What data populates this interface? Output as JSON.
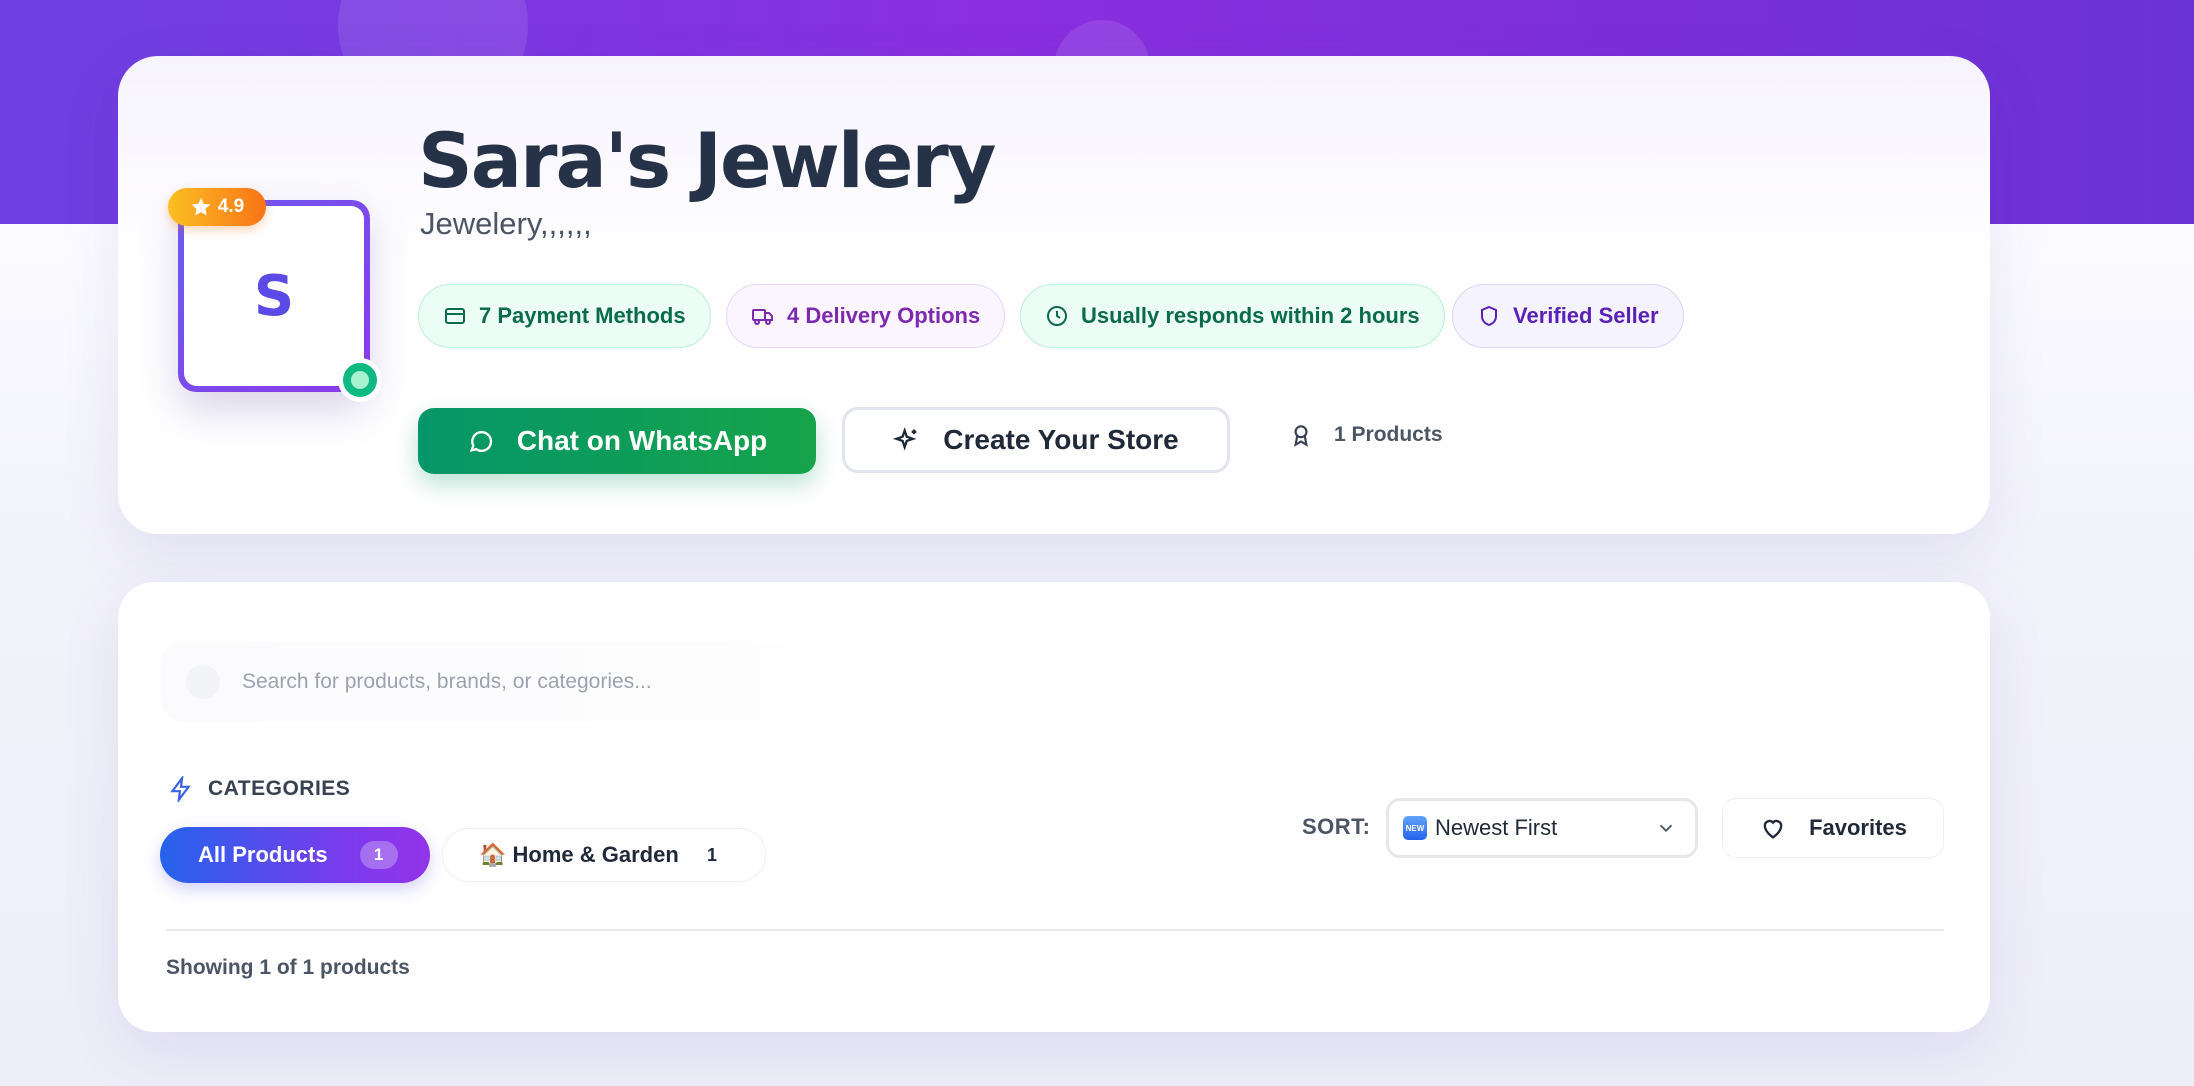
{
  "store": {
    "name": "Sara's Jewlery",
    "tagline": "Jewelery,,,,,,",
    "logo_letter": "S",
    "rating": "4.9",
    "online": true
  },
  "badges": [
    {
      "label": "7 Payment Methods",
      "icon": "credit-card-icon"
    },
    {
      "label": "4 Delivery Options",
      "icon": "truck-icon"
    },
    {
      "label": "Usually responds within 2 hours",
      "icon": "clock-icon"
    },
    {
      "label": "Verified Seller",
      "icon": "shield-icon"
    }
  ],
  "actions": {
    "whatsapp_label": "Chat on WhatsApp",
    "create_store_label": "Create Your Store",
    "products_count": "1 Products"
  },
  "search": {
    "placeholder": "Search for products, brands, or categories...",
    "value": ""
  },
  "categories": {
    "heading": "CATEGORIES",
    "items": [
      {
        "label": "All Products",
        "count": "1",
        "active": true
      },
      {
        "label": "🏠 Home & Garden",
        "count": "1",
        "active": false
      }
    ]
  },
  "sort": {
    "label": "SORT:",
    "selected_badge": "NEW",
    "selected": "Newest First"
  },
  "favorites_label": "Favorites",
  "results_text": "Showing 1 of 1 products",
  "colors": {
    "hero_gradient": [
      "#6d3fe0",
      "#8a2fe0"
    ],
    "whatsapp_green": "#059669",
    "accent_blue": "#2563eb",
    "accent_purple": "#9333ea",
    "rating_orange": "#f97316"
  }
}
